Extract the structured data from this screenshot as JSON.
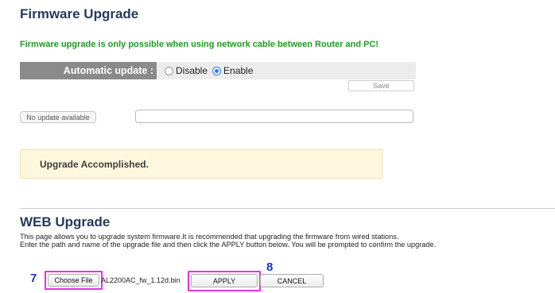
{
  "firmware": {
    "title": "Firmware Upgrade",
    "notice": "Firmware upgrade is only possible when using network cable between Router and PC!",
    "auto_update_label": "Automatic update :",
    "auto_update_options": [
      "Disable",
      "Enable"
    ],
    "auto_update_selected": "Enable",
    "save_label": "Save",
    "status_button_label": "No update available",
    "status_field_value": "",
    "success_message": "Upgrade Accomplished."
  },
  "web_upgrade": {
    "title": "WEB Upgrade",
    "description_line1": "This page allows you to upgrade system firmware.It is recommended that upgrading the firmware from wired stations.",
    "description_line2": "Enter the path and name of the upgrade file and then click the APPLY button below. You will be prompted to confirm the upgrade.",
    "choose_file_label": "Choose File",
    "file_name": "AL2200AC_fw_1.12d.bin",
    "apply_label": "APPLY",
    "cancel_label": "CANCEL",
    "step_choose": "7",
    "step_apply": "8"
  },
  "colors": {
    "title": "#263a5a",
    "notice": "#1f9a1f",
    "auto_bar": "#8a8a8a",
    "radio_selected": "#2b7de0",
    "success_bg": "#fdf7dd",
    "highlight": "#e432e4",
    "step_number": "#1a2fd0"
  }
}
